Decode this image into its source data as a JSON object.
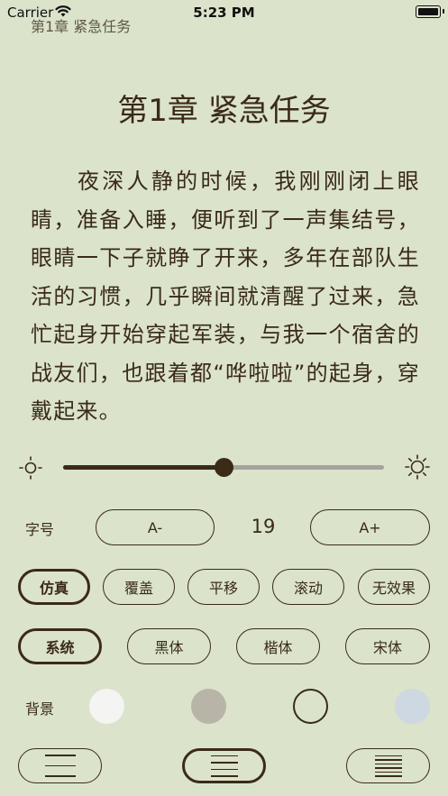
{
  "status_bar": {
    "carrier": "Carrier",
    "time": "5:23 PM"
  },
  "running_header": "第1章 紧急任务",
  "chapter": {
    "title": "第1章 紧急任务",
    "body": "夜深人静的时候，我刚刚闭上眼睛，准备入睡，便听到了一声集结号，眼睛一下子就睁了开来，多年在部队生活的习惯，几乎瞬间就清醒了过来，急忙起身开始穿起军装，与我一个宿舍的战友们，也跟着都“哗啦啦”的起身，穿戴起来。"
  },
  "brightness": {
    "level": 0.5,
    "low_icon": "sun-small-icon",
    "high_icon": "sun-large-icon"
  },
  "font_size": {
    "label": "字号",
    "decrease_label": "A-",
    "value": "19",
    "increase_label": "A+"
  },
  "page_turn": {
    "options": [
      {
        "label": "仿真",
        "selected": true
      },
      {
        "label": "覆盖",
        "selected": false
      },
      {
        "label": "平移",
        "selected": false
      },
      {
        "label": "滚动",
        "selected": false
      },
      {
        "label": "无效果",
        "selected": false
      }
    ]
  },
  "typeface": {
    "options": [
      {
        "label": "系统",
        "selected": true
      },
      {
        "label": "黑体",
        "selected": false
      },
      {
        "label": "楷体",
        "selected": false
      },
      {
        "label": "宋体",
        "selected": false
      }
    ]
  },
  "background": {
    "label": "背景",
    "swatches": [
      {
        "color": "#f4f4f2",
        "selected": false
      },
      {
        "color": "#b8b5a8",
        "selected": false
      },
      {
        "color": "#dbe3cb",
        "selected": true
      },
      {
        "color": "#cdd8e2",
        "selected": false
      }
    ]
  },
  "line_spacing": {
    "options": [
      {
        "icon": "line-spacing-wide-icon",
        "selected": false
      },
      {
        "icon": "line-spacing-medium-icon",
        "selected": true
      },
      {
        "icon": "line-spacing-tight-icon",
        "selected": false
      }
    ]
  },
  "colors": {
    "text": "#3a2a16",
    "page_background": "#dbe3cb",
    "track": "#a5a59e"
  }
}
